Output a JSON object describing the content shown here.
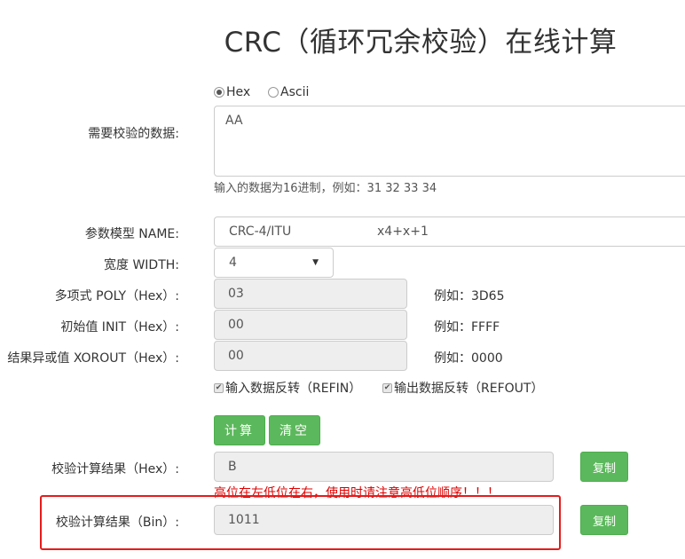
{
  "page": {
    "title": "CRC（循环冗余校验）在线计算"
  },
  "input_section": {
    "label": "需要校验的数据:",
    "radio_hex": "Hex",
    "radio_ascii": "Ascii",
    "selected_format": "Hex",
    "data_value": "AA",
    "hint": "输入的数据为16进制，例如：31 32 33 34"
  },
  "params": {
    "name_label": "参数模型 NAME:",
    "name_value": "CRC-4/ITU",
    "name_poly_formula": "x4+x+1",
    "width_label": "宽度 WIDTH:",
    "width_value": "4",
    "poly_label": "多项式 POLY（Hex）:",
    "poly_value": "03",
    "poly_example": "例如：3D65",
    "init_label": "初始值 INIT（Hex）:",
    "init_value": "00",
    "init_example": "例如：FFFF",
    "xorout_label": "结果异或值 XOROUT（Hex）:",
    "xorout_value": "00",
    "xorout_example": "例如：0000",
    "refin_label": "输入数据反转（REFIN）",
    "refin_checked": true,
    "refout_label": "输出数据反转（REFOUT）",
    "refout_checked": true
  },
  "actions": {
    "compute_label": "计算",
    "clear_label": "清空"
  },
  "results": {
    "hex_label": "校验计算结果（Hex）:",
    "hex_value": "B",
    "hex_copy_label": "复制",
    "warning": "高位在左低位在右，使用时请注意高低位顺序！！！",
    "bin_label": "校验计算结果（Bin）:",
    "bin_value": "1011",
    "bin_copy_label": "复制"
  },
  "colors": {
    "button_green": "#5cb85c",
    "warning_red": "#e00000",
    "highlight_red": "#e61b1b",
    "readonly_bg": "#eeeeee"
  }
}
